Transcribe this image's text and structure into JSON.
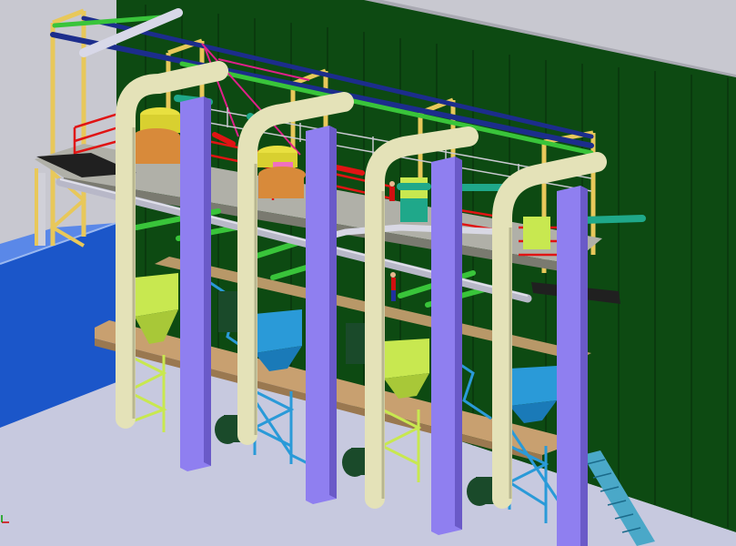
{
  "viewport": {
    "background_color": "#c8c8d0",
    "floor_color": "#c7c9df",
    "wall_color": "#0d4a12",
    "wall_top_color": "#a9a9b2",
    "left_block_color": "#1b56c9"
  },
  "colors": {
    "yellow_frame": "#e8c85a",
    "cream_pipe": "#e4e2b8",
    "purple_column": "#8f7ff0",
    "blue_pipe": "#1c2d8c",
    "green_pipe": "#39c43a",
    "magenta_pipe": "#e0208a",
    "teal_pipe": "#1fa88a",
    "red_railing": "#e01414",
    "gray_pipe": "#b8b8c8",
    "platform_wood": "#c8a070",
    "grating": "#b0b0a8",
    "lime_equipment": "#c8e850",
    "cyan_equipment": "#2a9ad8",
    "orange_equipment": "#d88a3a",
    "pink_equipment": "#f070c0",
    "dark_elbow": "#1a4a2a",
    "black_beam": "#202020"
  },
  "axis_indicator": {
    "icon": "xyz-axis-triad-icon",
    "label": ""
  }
}
